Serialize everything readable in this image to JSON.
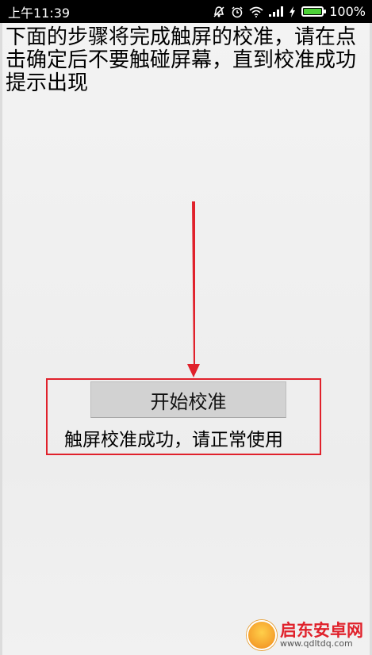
{
  "status_bar": {
    "time": "上午11:39",
    "battery_percent": "100%",
    "battery_level": 1.0,
    "icons": [
      "alarm-off-icon",
      "alarm-clock-icon",
      "wifi-icon",
      "signal-icon",
      "charging-icon",
      "battery-icon"
    ]
  },
  "calibration": {
    "instruction": "下面的步骤将完成触屏的校准，请在点击确定后不要触碰屏幕，直到校准成功提示出现",
    "start_button": "开始校准",
    "success_message": "触屏校准成功，请正常使用"
  },
  "annotations": {
    "arrow_color": "#e0212b",
    "box_color": "#e0212b"
  },
  "watermark": {
    "site_name": "启东安卓网",
    "url": "www.qdltdq.com"
  }
}
